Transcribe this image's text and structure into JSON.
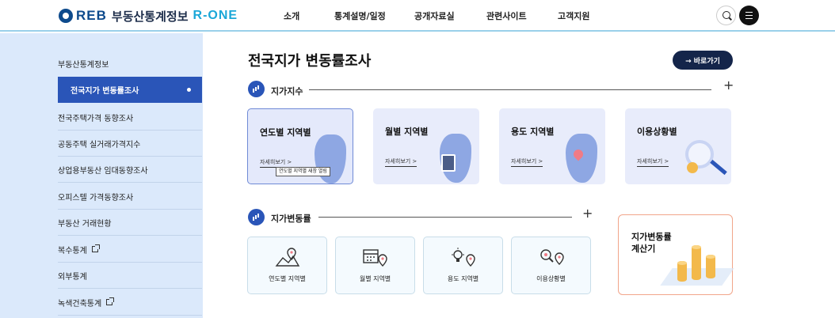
{
  "header": {
    "logo_reb": "REB",
    "logo_text": "부동산통계정보",
    "logo_rone": "R-ONE",
    "nav": [
      "소개",
      "통계설명/일정",
      "공개자료실",
      "관련사이트",
      "고객지원"
    ]
  },
  "sidebar": {
    "heading": "부동산통계정보",
    "items": [
      "전국지가 변동률조사",
      "전국주택가격 동향조사",
      "공동주택 실거래가격지수",
      "상업용부동산 임대동향조사",
      "오피스텔 가격동향조사",
      "부동산 거래현황",
      "복수통계",
      "외부통계",
      "녹색건축통계"
    ]
  },
  "main": {
    "title": "전국지가 변동률조사",
    "goto_label": "→ 바로가기",
    "section1": {
      "title": "지가지수",
      "cards": [
        {
          "title": "연도별 지역별",
          "more": "자세히보기 >"
        },
        {
          "title": "월별 지역별",
          "more": "자세히보기 >"
        },
        {
          "title": "용도 지역별",
          "more": "자세히보기 >"
        },
        {
          "title": "이용상황별",
          "more": "자세히보기 >"
        }
      ],
      "tooltip": "연도별 지역별 새창 열림"
    },
    "section2": {
      "title": "지가변동률",
      "cards": [
        {
          "label": "연도별 지역별"
        },
        {
          "label": "월별 지역별"
        },
        {
          "label": "용도 지역별"
        },
        {
          "label": "이용상황별"
        }
      ],
      "calc_line1": "지가변동률",
      "calc_line2": "계산기"
    }
  },
  "colors": {
    "brand": "#0d4a8c",
    "accent": "#2a55b8",
    "sidebar_bg": "#dbe9fb",
    "calc_border": "#f1a58a"
  }
}
